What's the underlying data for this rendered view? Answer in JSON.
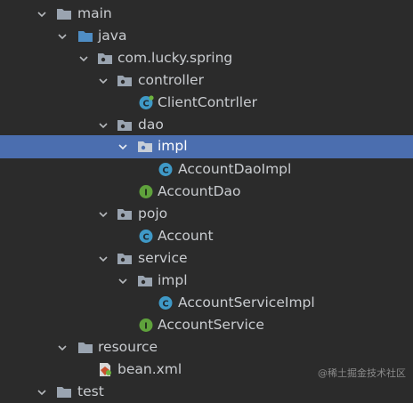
{
  "tree": {
    "main": "main",
    "java": "java",
    "package": "com.lucky.spring",
    "controller": "controller",
    "client_controller": "ClientContrller",
    "dao": "dao",
    "dao_impl": "impl",
    "account_dao_impl": "AccountDaoImpl",
    "account_dao": "AccountDao",
    "pojo": "pojo",
    "account": "Account",
    "service": "service",
    "service_impl": "impl",
    "account_service_impl": "AccountServiceImpl",
    "account_service": "AccountService",
    "resource": "resource",
    "bean_xml": "bean.xml",
    "test": "test"
  },
  "selected": "dao_impl",
  "watermark": "@稀土掘金技术社区",
  "colors": {
    "background": "#2b2b2b",
    "selection": "#4b6eaf",
    "text": "#c9ccd0",
    "class_icon": "#3f99c7",
    "interface_icon": "#5fa23c",
    "folder_icon": "#9aa4b0",
    "source_folder_icon": "#4f8dc4"
  }
}
